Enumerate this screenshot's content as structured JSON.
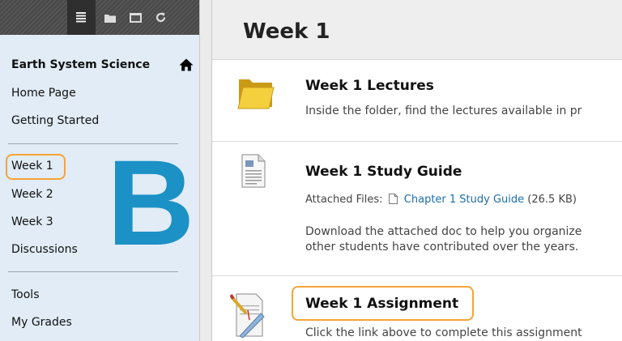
{
  "toolbar": {
    "tools": [
      {
        "name": "course-menu-icon",
        "active": true
      },
      {
        "name": "folder-view-icon",
        "active": false
      },
      {
        "name": "new-window-icon",
        "active": false
      },
      {
        "name": "refresh-icon",
        "active": false
      }
    ]
  },
  "sidebar": {
    "course_title": "Earth System Science",
    "items": [
      "Home Page",
      "Getting Started"
    ],
    "weeks": [
      "Week 1",
      "Week 2",
      "Week 3",
      "Discussions"
    ],
    "tools": [
      "Tools",
      "My Grades"
    ],
    "callout_letter": "B"
  },
  "content": {
    "page_title": "Week 1",
    "lectures": {
      "title": "Week 1 Lectures",
      "text": "Inside the folder, find the lectures available in pr"
    },
    "study_guide": {
      "title": "Week 1 Study Guide",
      "attached_label": "Attached Files:",
      "file_link": "Chapter 1 Study Guide",
      "file_size": "(26.5 KB)",
      "text_line1": "Download the attached doc to help you organize",
      "text_line2": "other students have contributed over the years."
    },
    "assignment": {
      "title": "Week 1 Assignment",
      "text": "Click the link above to complete this assignment"
    }
  },
  "colors": {
    "sidebar_bg": "#e1ecf6",
    "highlight": "#f5a437",
    "callout": "#1b91c5",
    "link": "#1d6ea8"
  }
}
